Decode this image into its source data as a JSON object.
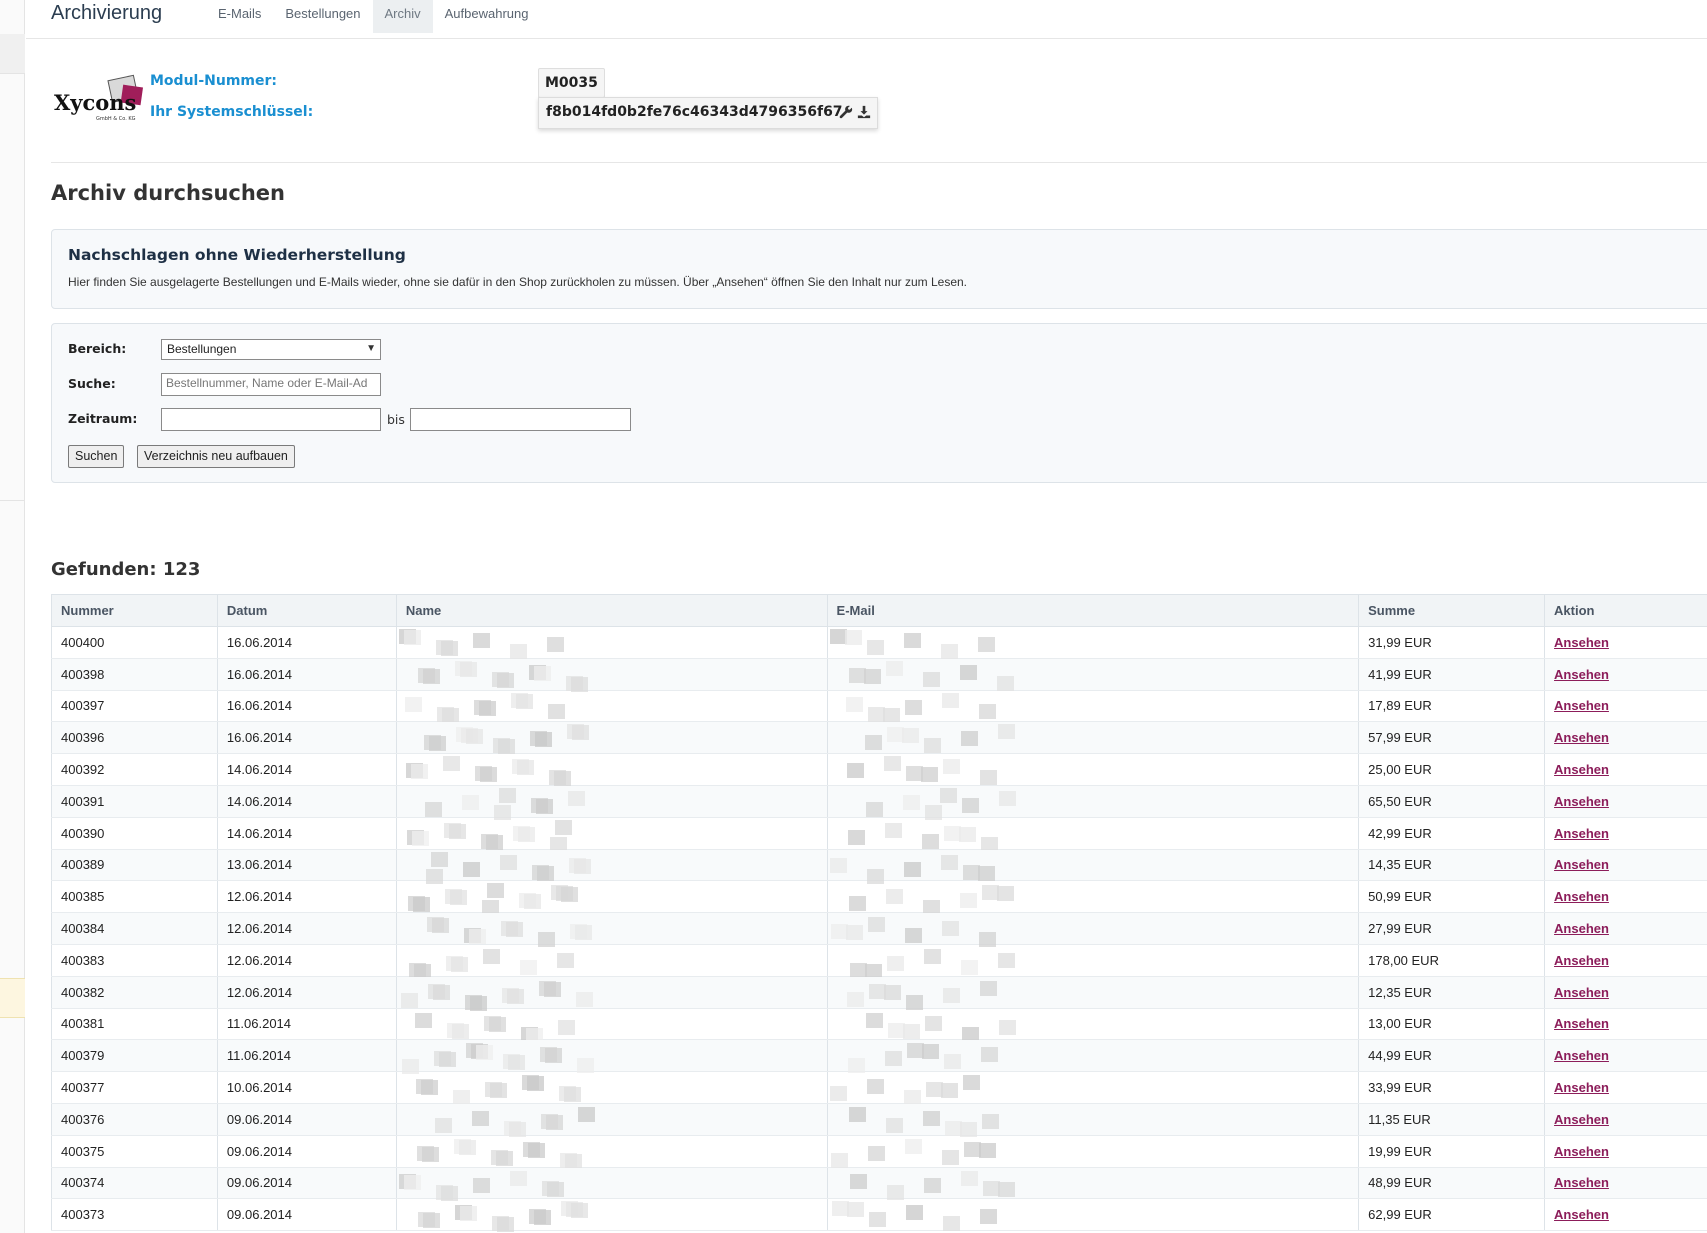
{
  "app": {
    "title": "Archivierung"
  },
  "tabs": [
    {
      "label": "E-Mails",
      "active": false
    },
    {
      "label": "Bestellungen",
      "active": false
    },
    {
      "label": "Archiv",
      "active": true
    },
    {
      "label": "Aufbewahrung",
      "active": false
    }
  ],
  "module": {
    "number_label": "Modul-Nummer:",
    "number_value": "M0035",
    "key_label": "Ihr Systemschlüssel:",
    "key_value": "f8b014fd0b2fe76c46343d4796356f67",
    "logo_text": "Xycons",
    "icons": [
      "wrench-icon",
      "download-icon"
    ]
  },
  "archive": {
    "title": "Archiv durchsuchen",
    "info_title": "Nachschlagen ohne Wiederherstellung",
    "info_text": "Hier finden Sie ausgelagerte Bestellungen und E-Mails wieder, ohne sie dafür in den Shop zurückholen zu müssen. Über „Ansehen“ öffnen Sie den Inhalt nur zum Lesen."
  },
  "form": {
    "bereich_label": "Bereich:",
    "bereich_value": "Bestellungen",
    "suche_label": "Suche:",
    "suche_placeholder": "Bestellnummer, Name oder E-Mail-Ad",
    "zeitraum_label": "Zeitraum:",
    "bis_label": "bis",
    "search_button": "Suchen",
    "rebuild_button": "Verzeichnis neu aufbauen"
  },
  "results": {
    "found_label": "Gefunden: 123",
    "columns": [
      "Nummer",
      "Datum",
      "Name",
      "E-Mail",
      "Summe",
      "Aktion"
    ],
    "action_label": "Ansehen",
    "rows": [
      {
        "nummer": "400400",
        "datum": "16.06.2014",
        "summe": "31,99 EUR"
      },
      {
        "nummer": "400398",
        "datum": "16.06.2014",
        "summe": "41,99 EUR"
      },
      {
        "nummer": "400397",
        "datum": "16.06.2014",
        "summe": "17,89 EUR"
      },
      {
        "nummer": "400396",
        "datum": "16.06.2014",
        "summe": "57,99 EUR"
      },
      {
        "nummer": "400392",
        "datum": "14.06.2014",
        "summe": "25,00 EUR"
      },
      {
        "nummer": "400391",
        "datum": "14.06.2014",
        "summe": "65,50 EUR"
      },
      {
        "nummer": "400390",
        "datum": "14.06.2014",
        "summe": "42,99 EUR"
      },
      {
        "nummer": "400389",
        "datum": "13.06.2014",
        "summe": "14,35 EUR"
      },
      {
        "nummer": "400385",
        "datum": "12.06.2014",
        "summe": "50,99 EUR"
      },
      {
        "nummer": "400384",
        "datum": "12.06.2014",
        "summe": "27,99 EUR"
      },
      {
        "nummer": "400383",
        "datum": "12.06.2014",
        "summe": "178,00 EUR"
      },
      {
        "nummer": "400382",
        "datum": "12.06.2014",
        "summe": "12,35 EUR"
      },
      {
        "nummer": "400381",
        "datum": "11.06.2014",
        "summe": "13,00 EUR"
      },
      {
        "nummer": "400379",
        "datum": "11.06.2014",
        "summe": "44,99 EUR"
      },
      {
        "nummer": "400377",
        "datum": "10.06.2014",
        "summe": "33,99 EUR"
      },
      {
        "nummer": "400376",
        "datum": "09.06.2014",
        "summe": "11,35 EUR"
      },
      {
        "nummer": "400375",
        "datum": "09.06.2014",
        "summe": "19,99 EUR"
      },
      {
        "nummer": "400374",
        "datum": "09.06.2014",
        "summe": "48,99 EUR"
      },
      {
        "nummer": "400373",
        "datum": "09.06.2014",
        "summe": "62,99 EUR"
      }
    ]
  }
}
